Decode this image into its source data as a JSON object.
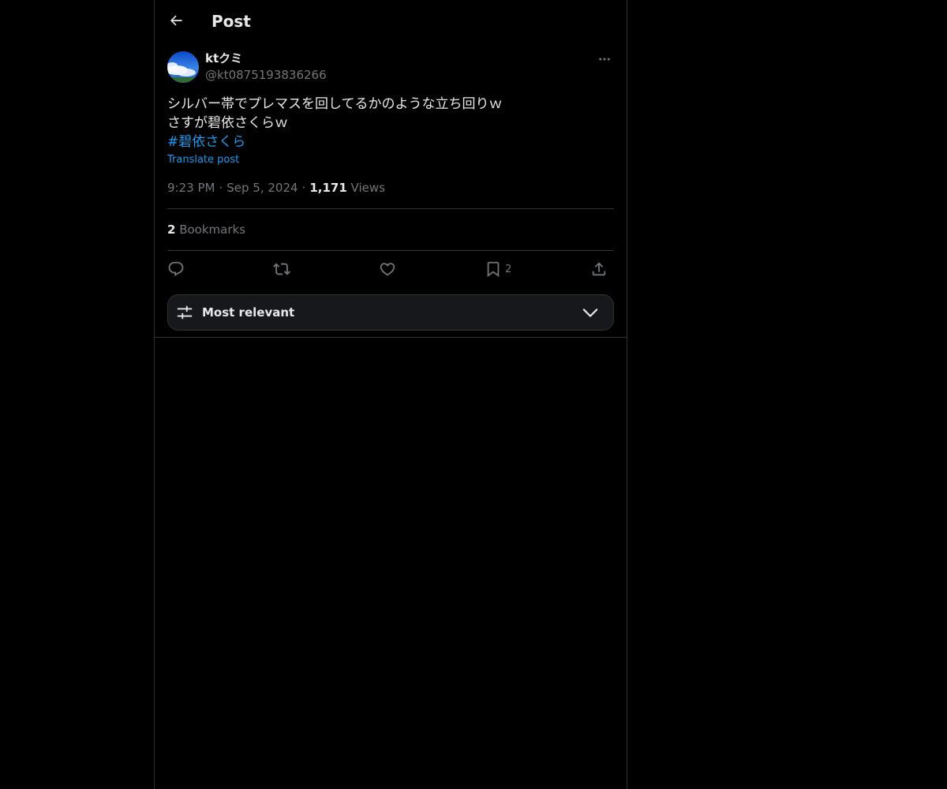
{
  "header": {
    "title": "Post"
  },
  "post": {
    "author": {
      "display_name": "ktクミ",
      "handle": "@kt0875193836266"
    },
    "text_lines": [
      "シルバー帯でプレマスを回してるかのような立ち回りｗ",
      "さすが碧依さくらｗ"
    ],
    "hashtag": "#碧依さくら",
    "translate_label": "Translate post",
    "time": "9:23 PM",
    "date": "Sep 5, 2024",
    "views_count": "1,171",
    "views_label": "Views",
    "separator": "·"
  },
  "stats": {
    "bookmarks_count": "2",
    "bookmarks_label": "Bookmarks"
  },
  "actions": {
    "reply": "reply-icon",
    "repost": "repost-icon",
    "like": "heart-icon",
    "bookmark": "bookmark-icon",
    "bookmark_count": "2",
    "share": "share-icon"
  },
  "replies_sort": {
    "label": "Most relevant"
  },
  "colors": {
    "background": "#000000",
    "text": "#e7e9ea",
    "secondary": "#71767b",
    "accent": "#1d9bf0",
    "border": "#2f3336"
  }
}
